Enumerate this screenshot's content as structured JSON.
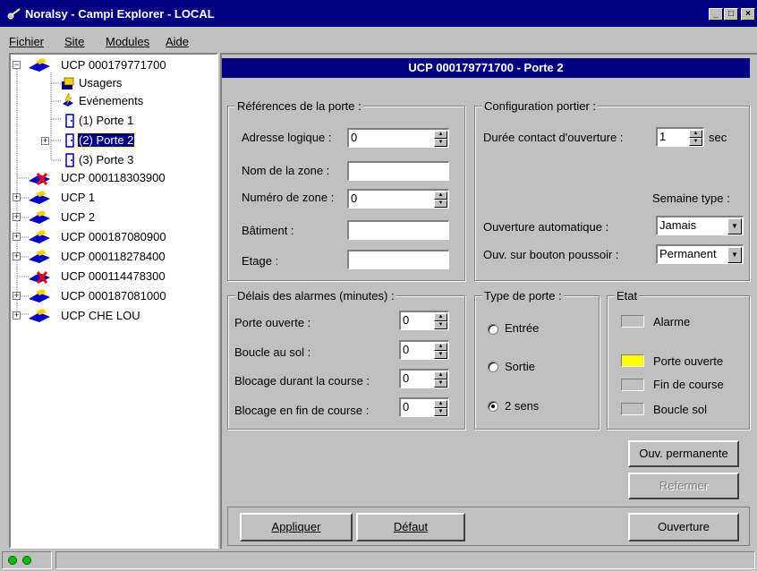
{
  "window": {
    "title": "Noralsy - Campi Explorer - LOCAL",
    "controls": {
      "minimize": "_",
      "maximize": "□",
      "close": "×"
    }
  },
  "menu": [
    {
      "label": "Fichier"
    },
    {
      "label": "Site"
    },
    {
      "label": "Modules"
    },
    {
      "label": "Aide"
    }
  ],
  "tree": {
    "nodes": [
      {
        "label": "UCP 000179771700",
        "icon": "controller-icon"
      },
      {
        "label": "Usagers",
        "icon": "users-icon"
      },
      {
        "label": "Evénements",
        "icon": "events-icon"
      },
      {
        "label": "(1) Porte 1",
        "icon": "door-icon"
      },
      {
        "label": "(2) Porte 2",
        "icon": "door-icon",
        "selected": true
      },
      {
        "label": "(3) Porte 3",
        "icon": "door-icon"
      },
      {
        "label": "UCP 000118303900",
        "icon": "controller-offline-icon"
      },
      {
        "label": "UCP 1",
        "icon": "controller-icon"
      },
      {
        "label": "UCP 2",
        "icon": "controller-icon"
      },
      {
        "label": "UCP 000187080900",
        "icon": "controller-icon"
      },
      {
        "label": "UCP 000118278400",
        "icon": "controller-icon"
      },
      {
        "label": "UCP 000114478300",
        "icon": "controller-offline-icon"
      },
      {
        "label": "UCP 000187081000",
        "icon": "controller-icon"
      },
      {
        "label": "UCP CHE LOU",
        "icon": "controller-icon"
      }
    ],
    "expander_collapsed": "+",
    "expander_expanded": "−"
  },
  "panel": {
    "title": "UCP 000179771700 - Porte 2",
    "references": {
      "title": "Références de la porte :",
      "adresse_label": "Adresse logique :",
      "adresse_value": "0",
      "nom_zone_label": "Nom de la zone :",
      "nom_zone_value": "",
      "numero_zone_label": "Numéro de zone :",
      "numero_zone_value": "0",
      "batiment_label": "Bâtiment :",
      "batiment_value": "",
      "etage_label": "Etage :",
      "etage_value": ""
    },
    "config": {
      "title": "Configuration portier :",
      "duree_label": "Durée contact d'ouverture :",
      "duree_value": "1",
      "duree_unit": "sec",
      "semaine_label": "Semaine type :",
      "ouverture_auto_label": "Ouverture automatique :",
      "ouverture_auto_value": "Jamais",
      "bouton_label": "Ouv. sur bouton poussoir :",
      "bouton_value": "Permanent"
    },
    "delais": {
      "title": "Délais des alarmes (minutes) :",
      "rows": [
        {
          "label": "Porte ouverte :",
          "value": "0"
        },
        {
          "label": "Boucle au sol :",
          "value": "0"
        },
        {
          "label": "Blocage durant la course :",
          "value": "0"
        },
        {
          "label": "Blocage en fin de course :",
          "value": "0"
        }
      ]
    },
    "type_porte": {
      "title": "Type de porte :",
      "options": [
        {
          "label": "Entrée",
          "selected": false
        },
        {
          "label": "Sortie",
          "selected": false
        },
        {
          "label": "2 sens",
          "selected": true
        }
      ]
    },
    "etat": {
      "title": "Etat",
      "items": [
        {
          "label": "Alarme",
          "color": "#c0c0c0"
        },
        {
          "label": "Porte ouverte",
          "color": "#ffff00"
        },
        {
          "label": "Fin de course",
          "color": "#c0c0c0"
        },
        {
          "label": "Boucle sol",
          "color": "#c0c0c0"
        }
      ]
    },
    "buttons": {
      "ouv_permanente": "Ouv. permanente",
      "refermer": "Refermer",
      "appliquer": "Appliquer",
      "defaut": "Défaut",
      "ouverture": "Ouverture"
    }
  },
  "colors": {
    "titlebar": "#000080",
    "face": "#c0c0c0",
    "status_led": "#00c000"
  }
}
